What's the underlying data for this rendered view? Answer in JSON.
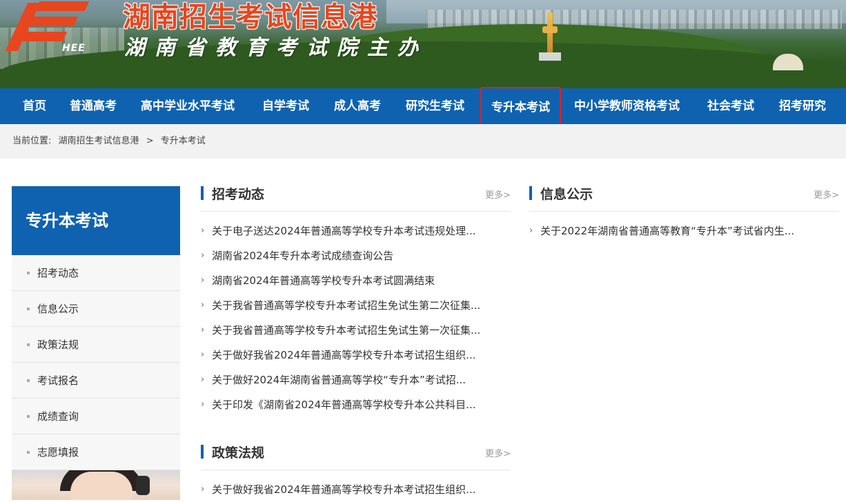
{
  "site": {
    "logo_text": "HEE",
    "title": "湖南招生考试信息港",
    "subtitle": "湖南省教育考试院主办"
  },
  "nav": {
    "items": [
      {
        "label": "首页"
      },
      {
        "label": "普通高考"
      },
      {
        "label": "高中学业水平考试"
      },
      {
        "label": "自学考试"
      },
      {
        "label": "成人高考"
      },
      {
        "label": "研究生考试"
      },
      {
        "label": "专升本考试"
      },
      {
        "label": "中小学教师资格考试"
      },
      {
        "label": "社会考试"
      },
      {
        "label": "招考研究"
      }
    ],
    "active_label": "专升本考试"
  },
  "breadcrumb": {
    "prefix": "当前位置:",
    "home": "湖南招生考试信息港",
    "sep": ">",
    "current": "专升本考试"
  },
  "sidebar": {
    "title": "专升本考试",
    "items": [
      {
        "label": "招考动态"
      },
      {
        "label": "信息公示"
      },
      {
        "label": "政策法规"
      },
      {
        "label": "考试报名"
      },
      {
        "label": "成绩查询"
      },
      {
        "label": "志愿填报"
      }
    ]
  },
  "sections": {
    "zhaokao": {
      "title": "招考动态",
      "more": "更多>",
      "items": [
        "关于电子送达2024年普通高等学校专升本考试违规处理...",
        "湖南省2024年专升本考试成绩查询公告",
        "湖南省2024年普通高等学校专升本考试圆满结束",
        "关于我省普通高等学校专升本考试招生免试生第二次征集...",
        "关于我省普通高等学校专升本考试招生免试生第一次征集...",
        "关于做好我省2024年普通高等学校专升本考试招生组织...",
        "关于做好2024年湖南省普通高等学校“专升本”考试招...",
        "关于印发《湖南省2024年普通高等学校专升本公共科目..."
      ]
    },
    "xinxi": {
      "title": "信息公示",
      "more": "更多>",
      "items": [
        "关于2022年湖南省普通高等教育“专升本”考试省内生..."
      ]
    },
    "zhengce": {
      "title": "政策法规",
      "more": "更多>",
      "items": [
        "关于做好我省2024年普通高等学校专升本考试招生组织..."
      ]
    }
  },
  "colors": {
    "nav_bg": "#0f62b0",
    "accent": "#e8461e",
    "highlight_border": "#e02020"
  }
}
